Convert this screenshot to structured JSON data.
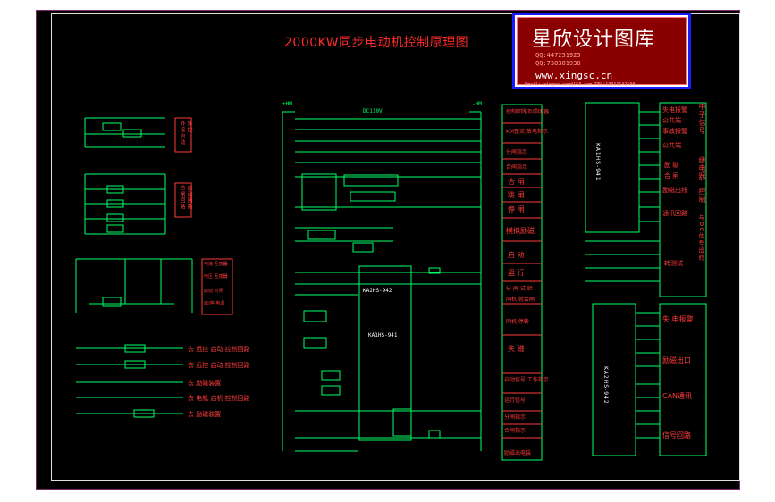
{
  "drawing": {
    "title": "2000KW同步电动机控制原理图",
    "voltage": "DC110V",
    "device_main": "KA1HS-941",
    "device_aux": "KA2HS-942",
    "relay_right": "KA1HS-941",
    "relay_right2": "KA2HS-942",
    "bus_left": "+HM",
    "bus_right": "-HM"
  },
  "logo": {
    "name": "星欣设计图库",
    "qq1": "QQ:447251925",
    "qq2": "QQ:738381938",
    "url": "www.xingsc.cn",
    "footer": "Email: xingsc.com@163.com   TEL:13311142598"
  },
  "function_column": [
    "控制回路及照明器",
    "KM整流\n放电指示",
    "分闸指示",
    "合闸指示",
    "合 闸",
    "跳 闸",
    "停 闸",
    "模拟励磁",
    "启 动",
    "运 行",
    "分 闸 试 验",
    "同机 就会闸",
    "同机 停转",
    "失 磁",
    "启动信号\n工作指示",
    "运行信号",
    "分闸指示",
    "合闸指示",
    "励磁出电装"
  ],
  "right_labels_top": [
    "失电报警",
    "公共端",
    "事故报警",
    "公共端",
    "励 磁",
    "合 闸",
    "励磁出线",
    "通讯回路",
    "转测试"
  ],
  "right_labels_vertical": [
    "中子信号",
    "继电器",
    "控制",
    "与DC信号出线"
  ],
  "right_labels_bottom": [
    "失 电报警",
    "励磁出口",
    "CAN通讯",
    "信号回路"
  ],
  "left_labels": [
    "外接启动",
    "外控",
    "合闸回路",
    "启动回路"
  ],
  "left_small_box": [
    "电流\n互感器",
    "电压\n互感器",
    "启动\n时间",
    "启/停\n电源"
  ],
  "legend_lines": [
    "去 远控 启动 控制回路",
    "去 远控 启动 控制回路",
    "去 励磁装置",
    "去 电机 启机 控制回路",
    "去 励磁装置"
  ]
}
